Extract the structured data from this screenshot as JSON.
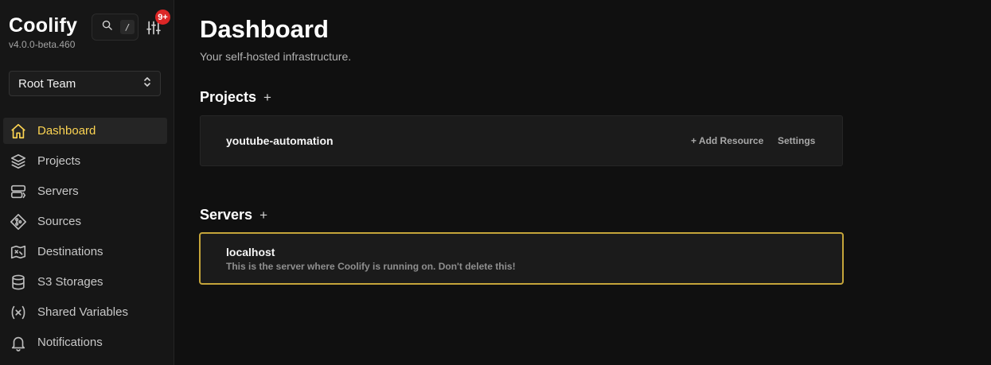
{
  "brand": {
    "title": "Coolify",
    "version": "v4.0.0-beta.460"
  },
  "search": {
    "shortcut": "/"
  },
  "notifications_badge": "9+",
  "team": {
    "selected": "Root Team"
  },
  "nav": {
    "items": [
      {
        "label": "Dashboard",
        "icon": "home-icon",
        "active": true
      },
      {
        "label": "Projects",
        "icon": "layers-icon"
      },
      {
        "label": "Servers",
        "icon": "server-icon"
      },
      {
        "label": "Sources",
        "icon": "git-branch-icon"
      },
      {
        "label": "Destinations",
        "icon": "map-icon"
      },
      {
        "label": "S3 Storages",
        "icon": "database-icon"
      },
      {
        "label": "Shared Variables",
        "icon": "variable-icon"
      },
      {
        "label": "Notifications",
        "icon": "bell-icon"
      }
    ]
  },
  "page": {
    "title": "Dashboard",
    "subtitle": "Your self-hosted infrastructure."
  },
  "projects": {
    "title": "Projects",
    "add_label": "+",
    "items": [
      {
        "name": "youtube-automation",
        "add_resource": "+ Add Resource",
        "settings": "Settings"
      }
    ]
  },
  "servers": {
    "title": "Servers",
    "add_label": "+",
    "items": [
      {
        "name": "localhost",
        "description": "This is the server where Coolify is running on. Don't delete this!"
      }
    ]
  },
  "colors": {
    "accent": "#fcd452",
    "badge": "#dc2626",
    "server_border": "#c5a53a",
    "background": "#101010"
  }
}
